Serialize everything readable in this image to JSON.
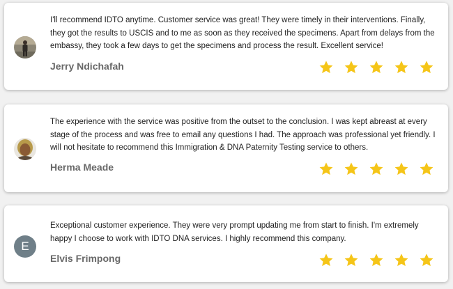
{
  "reviews": [
    {
      "text": "I'll recommend IDTO anytime. Customer service was great! They were timely in their interventions. Finally, they got the results to USCIS and to me as soon as they received the specimens. Apart from delays from the embassy, they took a few days to get the specimens and process the result. Excellent service!",
      "author": "Jerry Ndichafah",
      "rating": 5,
      "avatar": "photo"
    },
    {
      "text": "The experience with the service was positive from the outset to the conclusion. I was kept abreast at every stage of the process and was free to email any questions I had. The approach was professional yet friendly. I will not hesitate to recommend this Immigration & DNA Paternity Testing service to others.",
      "author": "Herma Meade",
      "rating": 5,
      "avatar": "photo"
    },
    {
      "text": "Exceptional customer experience. They were very prompt updating me from start to finish. I'm extremely happy I choose to work with IDTO DNA services. I highly recommend this company.",
      "author": "Elvis Frimpong",
      "rating": 5,
      "avatar": "initial",
      "initial": "E"
    }
  ],
  "colors": {
    "star": "#f5c518",
    "initial_avatar_bg": "#6f7f88",
    "name": "#686868"
  },
  "icons": [
    "star-icon",
    "avatar-photo"
  ]
}
